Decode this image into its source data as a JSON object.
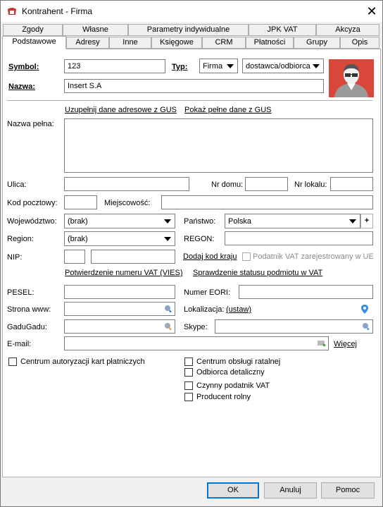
{
  "window": {
    "title": "Kontrahent - Firma",
    "close": "✕"
  },
  "tabs_top": [
    "Zgody",
    "Własne",
    "Parametry indywidualne",
    "JPK VAT",
    "Akcyza"
  ],
  "tabs_bottom": [
    "Podstawowe",
    "Adresy",
    "Inne",
    "Księgowe",
    "CRM",
    "Płatności",
    "Grupy",
    "Opis"
  ],
  "active_tab": "Podstawowe",
  "header": {
    "symbol_label": "Symbol:",
    "symbol_value": "123",
    "typ_label": "Typ:",
    "typ_value": "Firma",
    "role_value": "dostawca/odbiorca",
    "nazwa_label": "Nazwa:",
    "nazwa_value": "Insert S.A"
  },
  "links": {
    "gus_fill": "Uzupełnij dane adresowe z GUS",
    "gus_show": "Pokaż pełne dane z GUS",
    "add_country_code": "Dodaj kod kraju",
    "vies": "Potwierdzenie numeru VAT (VIES)",
    "vat_status": "Sprawdzenie statusu podmiotu w VAT",
    "ustaw": "(ustaw)",
    "wiecej": "Więcej"
  },
  "form": {
    "nazwa_pelna_label": "Nazwa pełna:",
    "ulica_label": "Ulica:",
    "nr_domu_label": "Nr domu:",
    "nr_lokalu_label": "Nr lokalu:",
    "kod_label": "Kod pocztowy:",
    "miejscowosc_label": "Miejscowość:",
    "wojewodztwo_label": "Województwo:",
    "wojewodztwo_value": "(brak)",
    "panstwo_label": "Państwo:",
    "panstwo_value": "Polska",
    "region_label": "Region:",
    "region_value": "(brak)",
    "regon_label": "REGON:",
    "nip_label": "NIP:",
    "vat_ue_label": "Podatnik VAT zarejestrowany w UE",
    "pesel_label": "PESEL:",
    "eori_label": "Numer EORI:",
    "www_label": "Strona www:",
    "lokalizacja_label": "Lokalizacja:",
    "gadugadu_label": "GaduGadu:",
    "skype_label": "Skype:",
    "email_label": "E-mail:",
    "plus": "+"
  },
  "checkboxes": {
    "card_center": "Centrum autoryzacji kart płatniczych",
    "installment_center": "Centrum obsługi ratalnej",
    "retail": "Odbiorca detaliczny",
    "active_vat": "Czynny podatnik VAT",
    "farmer": "Producent rolny"
  },
  "buttons": {
    "ok": "OK",
    "cancel": "Anuluj",
    "help": "Pomoc"
  },
  "colors": {
    "accent": "#0078d7",
    "avatar_bg": "#d9473a"
  },
  "icons": [
    "app-icon",
    "close-icon",
    "dropdown-arrow-icon",
    "globe-icon",
    "map-pin-icon",
    "gadugadu-icon",
    "skype-icon",
    "email-icon",
    "person-avatar-icon"
  ]
}
